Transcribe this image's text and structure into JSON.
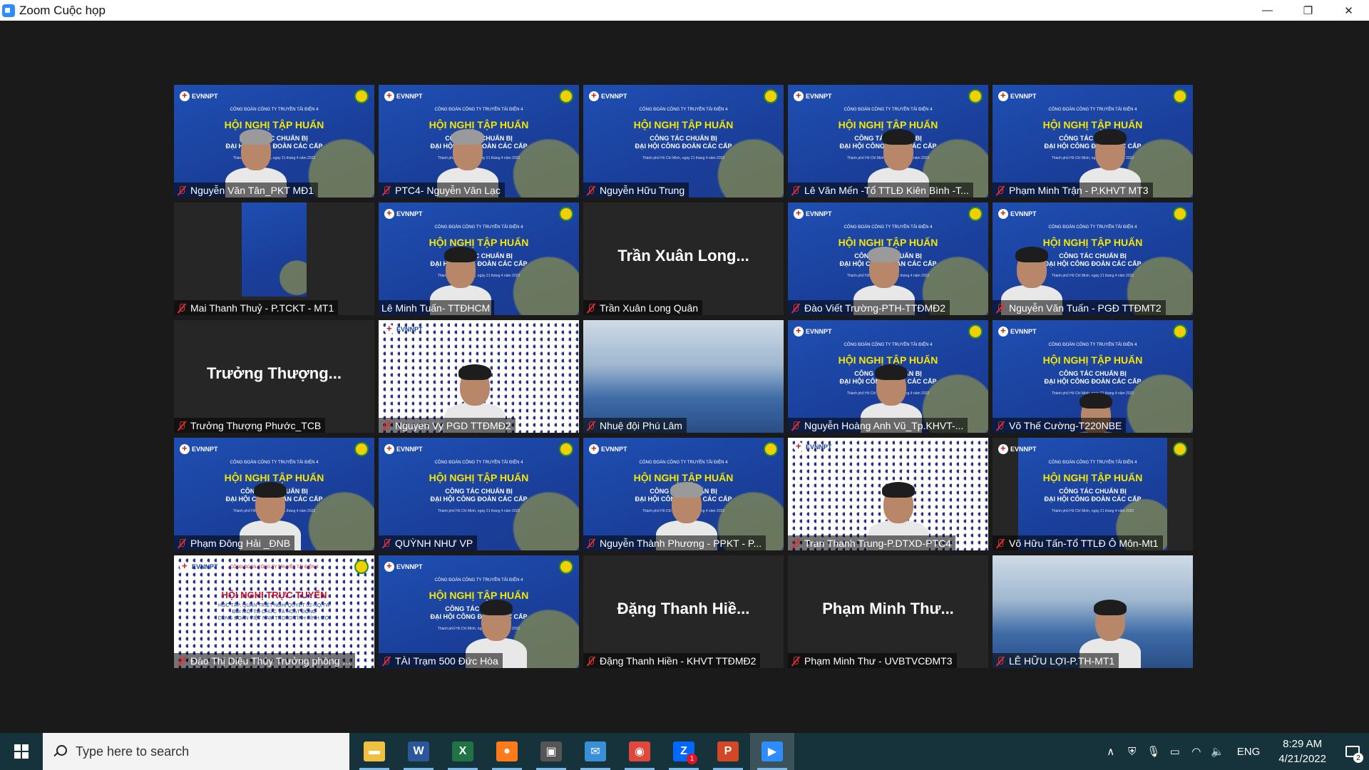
{
  "window": {
    "title": "Zoom Cuộc họp",
    "minimize": "—",
    "maximize": "❐",
    "close": "✕"
  },
  "slide": {
    "union": "CÔNG ĐOÀN CÔNG TY TRUYỀN TẢI ĐIỆN 4",
    "title": "HỘI NGHỊ TẬP HUẤN",
    "subtitle_1": "CÔNG TÁC CHUẨN BỊ",
    "subtitle_2": "ĐẠI HỘI CÔNG ĐOÀN CÁC CẤP",
    "date": "Thành phố Hồ Chí Minh, ngày 21 tháng 4 năm 2022",
    "logo": "EVNNPT"
  },
  "slide_online": {
    "title": "HỘI NGHỊ TRỰC TUYẾN",
    "line_1": "HỌC TẬP, QUÁN TRIỆT NGHỊ QUYẾT 02-NQ/TW",
    "line_2": "ĐỔI MỚI TỔ CHỨC VÀ HOẠT ĐỘNG",
    "line_3": "CÔNG ĐOÀN VIỆT NAM TRONG TÌNH HÌNH MỚI"
  },
  "participants": [
    {
      "name": "Nguyễn Văn Tân_PKT MĐ1",
      "muted": true
    },
    {
      "name": "PTC4- Nguyễn Văn Lạc",
      "muted": true
    },
    {
      "name": "Nguyễn Hữu Trung",
      "muted": true
    },
    {
      "name": "Lê Văn Mến -Tổ TTLĐ Kiên Bình -T...",
      "muted": true
    },
    {
      "name": "Phạm Minh Trận - P.KHVT MT3",
      "muted": true
    },
    {
      "name": "Mai Thanh Thuỷ - P.TCKT - MT1",
      "muted": true
    },
    {
      "name": "Lê Minh Tuấn- TTĐHCM",
      "muted": false
    },
    {
      "name": "Trần Xuân Long Quân",
      "muted": true,
      "display": "Trần Xuân Long..."
    },
    {
      "name": "Đào Viết Trường-PTH-TTĐMĐ2",
      "muted": true
    },
    {
      "name": "Nguyễn Văn Tuấn - PGĐ TTĐMT2",
      "muted": true
    },
    {
      "name": "Trưởng Thượng Phước_TCB",
      "muted": true,
      "display": "Trưởng Thượng..."
    },
    {
      "name": "Nguyen Vy PGD TTĐMĐ2",
      "muted": true
    },
    {
      "name": "Nhuệ đội Phú Lâm",
      "muted": true
    },
    {
      "name": "Nguyễn Hoàng Anh Vũ_Tp.KHVT-...",
      "muted": true
    },
    {
      "name": "Võ Thế Cường-T220NBE",
      "muted": true
    },
    {
      "name": "Phạm Đông Hải _ĐNB",
      "muted": true
    },
    {
      "name": "QUỲNH NHƯ VP",
      "muted": true
    },
    {
      "name": "Nguyễn Thành Phương - PPKT - P...",
      "muted": true
    },
    {
      "name": "Tran Thanh Trung-P.DTXD-PTC4",
      "muted": true,
      "active": true
    },
    {
      "name": "Võ Hữu Tấn-Tổ TTLĐ Ô Môn-Mt1",
      "muted": true
    },
    {
      "name": "Đào Thị Diệu Thúy Trưởng phòng ...",
      "muted": true
    },
    {
      "name": "TÀI Trạm 500 Đức Hòa",
      "muted": true
    },
    {
      "name": "Đặng Thanh Hiền - KHVT TTĐMĐ2",
      "muted": true,
      "display": "Đặng Thanh Hiề..."
    },
    {
      "name": "Phạm Minh Thư - UVBTVCĐMT3",
      "muted": true,
      "display": "Phạm Minh Thư..."
    },
    {
      "name": "LÊ HỮU LỢI-P.TH-MT1",
      "muted": true
    }
  ],
  "taskbar": {
    "search_placeholder": "Type here to search",
    "apps": [
      {
        "name": "File Explorer",
        "glyph": "▬",
        "color": "#f0c040"
      },
      {
        "name": "Word",
        "glyph": "W",
        "color": "#2b579a"
      },
      {
        "name": "Excel",
        "glyph": "X",
        "color": "#217346"
      },
      {
        "name": "Firefox",
        "glyph": "●",
        "color": "#ff7a1a"
      },
      {
        "name": "Presentation",
        "glyph": "▣",
        "color": "#555555"
      },
      {
        "name": "Outlook",
        "glyph": "✉",
        "color": "#3a8fd9"
      },
      {
        "name": "Chrome",
        "glyph": "◉",
        "color": "#e0483b"
      },
      {
        "name": "Zalo",
        "glyph": "Z",
        "color": "#0068ff",
        "badge": "1"
      },
      {
        "name": "PowerPoint",
        "glyph": "P",
        "color": "#d24726"
      },
      {
        "name": "Zoom",
        "glyph": "▶",
        "color": "#2d8cff"
      }
    ],
    "tray_up": "∧",
    "language": "ENG",
    "time": "8:29 AM",
    "date": "4/21/2022",
    "notification_count": "2"
  }
}
